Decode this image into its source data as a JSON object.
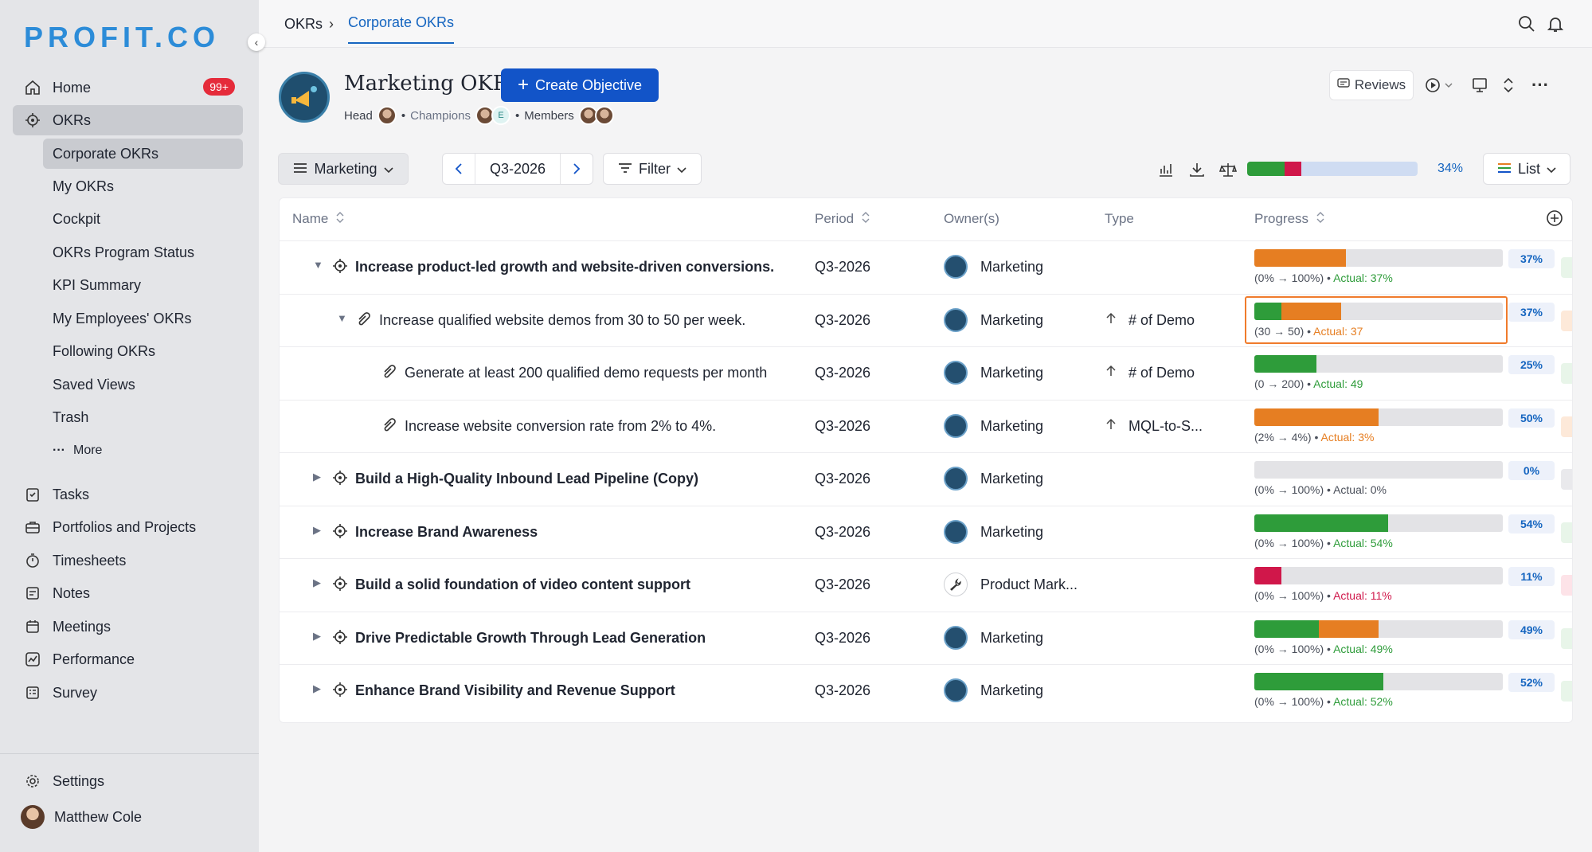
{
  "app": {
    "logo": "PROFIT.CO"
  },
  "sidebar": {
    "home": {
      "label": "Home",
      "badge": "99+"
    },
    "okrs": {
      "label": "OKRs"
    },
    "okr_sub": [
      {
        "label": "Corporate OKRs"
      },
      {
        "label": "My OKRs"
      },
      {
        "label": "Cockpit"
      },
      {
        "label": "OKRs Program Status"
      },
      {
        "label": "KPI Summary"
      },
      {
        "label": "My Employees' OKRs"
      },
      {
        "label": "Following OKRs"
      },
      {
        "label": "Saved Views"
      },
      {
        "label": "Trash"
      },
      {
        "label": "More"
      }
    ],
    "items": [
      {
        "label": "Tasks"
      },
      {
        "label": "Portfolios and Projects"
      },
      {
        "label": "Timesheets"
      },
      {
        "label": "Notes"
      },
      {
        "label": "Meetings"
      },
      {
        "label": "Performance"
      },
      {
        "label": "Survey"
      }
    ],
    "settings": "Settings",
    "user": "Matthew Cole"
  },
  "breadcrumb": {
    "root": "OKRs",
    "current": "Corporate OKRs"
  },
  "header": {
    "title": "Marketing OKRs",
    "create_button": "Create Objective",
    "head_label": "Head",
    "champions_label": "Champions",
    "members_label": "Members",
    "champion_initial": "E",
    "reviews_button": "Reviews"
  },
  "toolbar": {
    "group_selector": "Marketing",
    "period": "Q3-2026",
    "filter": "Filter",
    "overall_progress": "34%",
    "overall_progress_value": 34,
    "view": "List"
  },
  "table": {
    "columns": {
      "name": "Name",
      "period": "Period",
      "owners": "Owner(s)",
      "type": "Type",
      "progress": "Progress"
    },
    "rows": [
      {
        "level": 0,
        "expanded": true,
        "name": "Increase product-led growth and website-driven conversions.",
        "period": "Q3-2026",
        "owner": "Marketing",
        "type": "",
        "range": "(0% → 100%)",
        "actual": "Actual: 37%",
        "pct": "37%",
        "segments": [
          {
            "w": 37,
            "c": "#e67e22"
          }
        ],
        "actual_color": "#2e9c3a",
        "flag": "#e8f5e9"
      },
      {
        "level": 1,
        "expanded": true,
        "name": "Increase qualified website demos from 30 to 50 per week.",
        "period": "Q3-2026",
        "owner": "Marketing",
        "type": "# of Demo",
        "range": "(30 → 50)",
        "actual": "Actual: 37",
        "pct": "37%",
        "segments": [
          {
            "w": 11,
            "c": "#2e9c3a"
          },
          {
            "w": 24,
            "c": "#e67e22"
          }
        ],
        "actual_color": "#e67e22",
        "flag": "#fde9d9"
      },
      {
        "level": 2,
        "name": "Generate at least 200 qualified demo requests per month",
        "period": "Q3-2026",
        "owner": "Marketing",
        "type": "# of Demo",
        "range": "(0 → 200)",
        "actual": "Actual: 49",
        "pct": "25%",
        "segments": [
          {
            "w": 25,
            "c": "#2e9c3a"
          }
        ],
        "actual_color": "#2e9c3a",
        "flag": "#e8f5e9"
      },
      {
        "level": 2,
        "name": "Increase website conversion rate from 2% to 4%.",
        "period": "Q3-2026",
        "owner": "Marketing",
        "type": "MQL-to-S...",
        "range": "(2% → 4%)",
        "actual": "Actual: 3%",
        "pct": "50%",
        "segments": [
          {
            "w": 50,
            "c": "#e67e22"
          }
        ],
        "actual_color": "#e67e22",
        "flag": "#fde9d9"
      },
      {
        "level": 0,
        "expanded": false,
        "name": "Build a High-Quality Inbound Lead Pipeline (Copy)",
        "period": "Q3-2026",
        "owner": "Marketing",
        "type": "",
        "range": "(0% → 100%)",
        "actual": "Actual: 0%",
        "pct": "0%",
        "segments": [],
        "actual_color": "#4a4f5a",
        "flag": "#e9e9ec"
      },
      {
        "level": 0,
        "expanded": false,
        "name": "Increase Brand Awareness",
        "period": "Q3-2026",
        "owner": "Marketing",
        "type": "",
        "range": "(0% → 100%)",
        "actual": "Actual: 54%",
        "pct": "54%",
        "segments": [
          {
            "w": 54,
            "c": "#2e9c3a"
          }
        ],
        "actual_color": "#2e9c3a",
        "flag": "#e8f5e9"
      },
      {
        "level": 0,
        "expanded": false,
        "name": "Build a solid foundation of video content support",
        "period": "Q3-2026",
        "owner": "Product Mark...",
        "owner_tool": true,
        "type": "",
        "range": "(0% → 100%)",
        "actual": "Actual: 11%",
        "pct": "11%",
        "segments": [
          {
            "w": 11,
            "c": "#d0174a"
          }
        ],
        "actual_color": "#d0174a",
        "flag": "#fde3e8"
      },
      {
        "level": 0,
        "expanded": false,
        "name": "Drive Predictable Growth Through Lead Generation",
        "period": "Q3-2026",
        "owner": "Marketing",
        "type": "",
        "range": "(0% → 100%)",
        "actual": "Actual: 49%",
        "pct": "49%",
        "segments": [
          {
            "w": 26,
            "c": "#2e9c3a"
          },
          {
            "w": 24,
            "c": "#e67e22"
          }
        ],
        "actual_color": "#2e9c3a",
        "flag": "#e8f5e9"
      },
      {
        "level": 0,
        "expanded": false,
        "name": "Enhance Brand Visibility and Revenue Support",
        "period": "Q3-2026",
        "owner": "Marketing",
        "type": "",
        "range": "(0% → 100%)",
        "actual": "Actual: 52%",
        "pct": "52%",
        "segments": [
          {
            "w": 52,
            "c": "#2e9c3a"
          }
        ],
        "actual_color": "#2e9c3a",
        "flag": "#e8f5e9"
      }
    ]
  },
  "colors": {
    "accent": "#1254c8",
    "green": "#2e9c3a",
    "orange": "#e67e22",
    "red": "#d0174a"
  }
}
